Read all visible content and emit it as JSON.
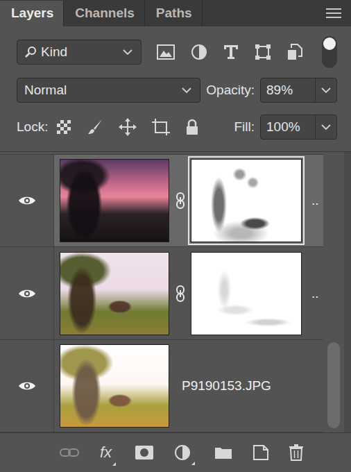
{
  "tabs": [
    {
      "label": "Layers",
      "selected": true
    },
    {
      "label": "Channels",
      "selected": false
    },
    {
      "label": "Paths",
      "selected": false
    }
  ],
  "filter": {
    "label": "Kind",
    "enabled": false
  },
  "blend_mode": "Normal",
  "opacity": {
    "label": "Opacity:",
    "value": "89%"
  },
  "lock": {
    "label": "Lock:"
  },
  "fill": {
    "label": "Fill:",
    "value": "100%"
  },
  "layers": [
    {
      "name": "..",
      "visible": true,
      "selected": true,
      "has_mask": true,
      "linked": true,
      "mask_selected": true
    },
    {
      "name": "..",
      "visible": true,
      "selected": false,
      "has_mask": true,
      "linked": true,
      "mask_selected": false
    },
    {
      "name": "P9190153.JPG",
      "visible": true,
      "selected": false,
      "has_mask": false,
      "linked": false,
      "mask_selected": false
    }
  ],
  "toolbar": {
    "effects_label": "fx",
    "link_disabled": true
  }
}
